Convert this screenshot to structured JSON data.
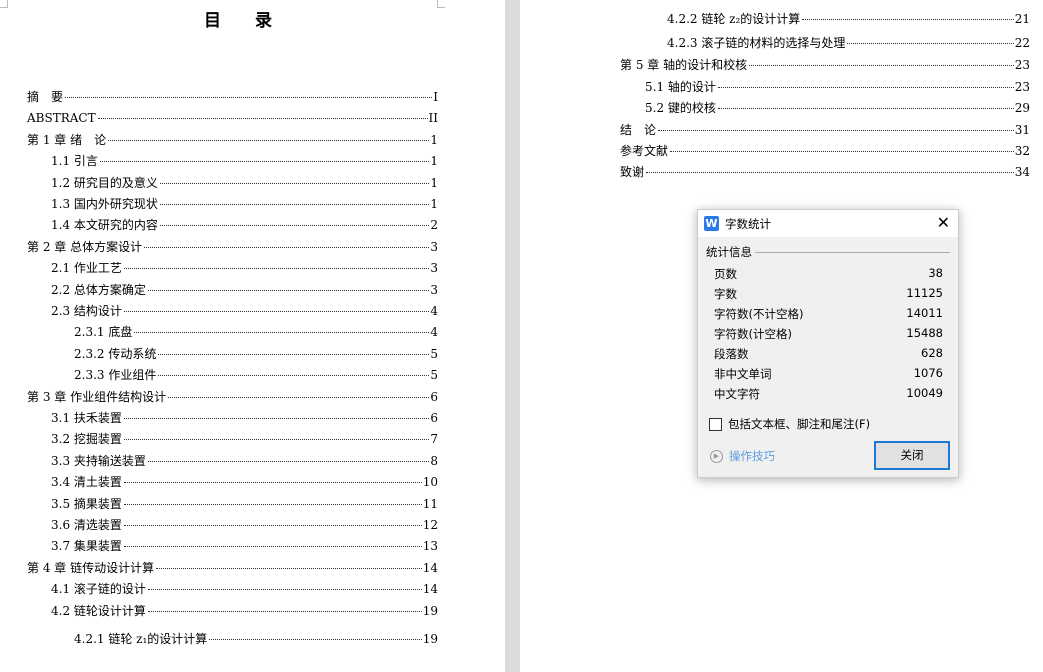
{
  "left_page": {
    "title": "目 录",
    "entries": [
      {
        "text": "摘　要",
        "page": "I",
        "level": 1
      },
      {
        "text": "ABSTRACT",
        "page": "II",
        "level": 1
      },
      {
        "text": "第 1 章 绪　论",
        "page": "1",
        "level": 1
      },
      {
        "text": "1.1 引言",
        "page": "1",
        "level": 2
      },
      {
        "text": "1.2 研究目的及意义",
        "page": "1",
        "level": 2
      },
      {
        "text": "1.3 国内外研究现状",
        "page": "1",
        "level": 2
      },
      {
        "text": "1.4 本文研究的内容",
        "page": "2",
        "level": 2
      },
      {
        "text": "第 2 章 总体方案设计",
        "page": "3",
        "level": 1
      },
      {
        "text": "2.1 作业工艺",
        "page": "3",
        "level": 2
      },
      {
        "text": "2.2 总体方案确定",
        "page": "3",
        "level": 2
      },
      {
        "text": "2.3 结构设计",
        "page": "4",
        "level": 2
      },
      {
        "text": "2.3.1 底盘",
        "page": "4",
        "level": 3
      },
      {
        "text": "2.3.2 传动系统",
        "page": "5",
        "level": 3
      },
      {
        "text": "2.3.3 作业组件",
        "page": "5",
        "level": 3
      },
      {
        "text": "第 3 章 作业组件结构设计",
        "page": "6",
        "level": 1
      },
      {
        "text": "3.1 扶禾装置",
        "page": "6",
        "level": 2
      },
      {
        "text": "3.2 挖掘装置",
        "page": "7",
        "level": 2
      },
      {
        "text": "3.3 夹持输送装置",
        "page": "8",
        "level": 2
      },
      {
        "text": "3.4 清土装置",
        "page": "10",
        "level": 2
      },
      {
        "text": "3.5 摘果装置",
        "page": "11",
        "level": 2
      },
      {
        "text": "3.6 清选装置",
        "page": "12",
        "level": 2
      },
      {
        "text": "3.7 集果装置",
        "page": "13",
        "level": 2
      },
      {
        "text": "第 4 章 链传动设计计算",
        "page": "14",
        "level": 1
      },
      {
        "text": "4.1 滚子链的设计",
        "page": "14",
        "level": 2
      },
      {
        "text": "4.2 链轮设计计算",
        "page": "19",
        "level": 2
      },
      {
        "text": "4.2.1 链轮 z₁的设计计算",
        "page": "19",
        "level": 3
      }
    ]
  },
  "right_page": {
    "entries": [
      {
        "text": "4.2.2 链轮 z₂的设计计算",
        "page": "21",
        "level": 3
      },
      {
        "text": "4.2.3 滚子链的材料的选择与处理",
        "page": "22",
        "level": 3
      },
      {
        "text": "第 5 章 轴的设计和校核",
        "page": "23",
        "level": 1
      },
      {
        "text": "5.1 轴的设计",
        "page": "23",
        "level": 2
      },
      {
        "text": "5.2 键的校核",
        "page": "29",
        "level": 2
      },
      {
        "text": "结　论",
        "page": "31",
        "level": 1
      },
      {
        "text": "参考文献",
        "page": "32",
        "level": 1
      },
      {
        "text": "致谢",
        "page": "34",
        "level": 1
      }
    ]
  },
  "dialog": {
    "title": "字数统计",
    "group_label": "统计信息",
    "stats": [
      {
        "label": "页数",
        "value": "38"
      },
      {
        "label": "字数",
        "value": "11125"
      },
      {
        "label": "字符数(不计空格)",
        "value": "14011"
      },
      {
        "label": "字符数(计空格)",
        "value": "15488"
      },
      {
        "label": "段落数",
        "value": "628"
      },
      {
        "label": "非中文单词",
        "value": "1076"
      },
      {
        "label": "中文字符",
        "value": "10049"
      }
    ],
    "checkbox_label": "包括文本框、脚注和尾注(F)",
    "checkbox_checked": false,
    "tips_label": "操作技巧",
    "close_button": "关闭",
    "accent": "#1a7ad4"
  }
}
